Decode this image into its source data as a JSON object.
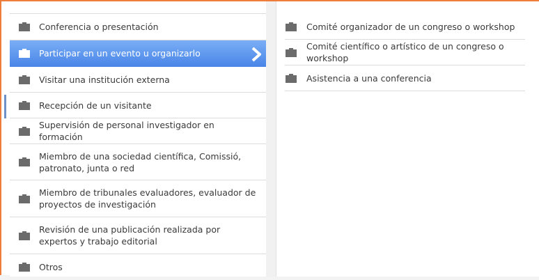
{
  "left_menu": {
    "items": [
      {
        "label": "Conferencia o presentación",
        "icon": "briefcase-icon"
      },
      {
        "label": "Participar en un evento u organizarlo",
        "icon": "briefcase-icon",
        "selected": true
      },
      {
        "label": "Visitar una institución externa",
        "icon": "briefcase-icon"
      },
      {
        "label": "Recepción de un visitante",
        "icon": "briefcase-icon"
      },
      {
        "label": "Supervisión de personal investigador en formación",
        "icon": "briefcase-icon"
      },
      {
        "label": "Miembro de una sociedad científica, Comissió, patronato, junta o red",
        "icon": "briefcase-icon"
      },
      {
        "label": "Miembro de tribunales evaluadores, evaluador de proyectos de investigación",
        "icon": "briefcase-icon"
      },
      {
        "label": "Revisión de una publicación realizada por expertos y trabajo editorial",
        "icon": "briefcase-icon"
      },
      {
        "label": "Otros",
        "icon": "briefcase-icon"
      }
    ]
  },
  "right_menu": {
    "items": [
      {
        "label": "Comité organizador de un congreso o workshop",
        "icon": "briefcase-icon"
      },
      {
        "label": "Comité científico o artístico de un congreso o workshop",
        "icon": "briefcase-icon"
      },
      {
        "label": "Asistencia a una conferencia",
        "icon": "briefcase-icon"
      }
    ]
  },
  "colors": {
    "accent_border": "#ee7c3b",
    "selected_bg": "#4a86e8",
    "icon_gray": "#6b6b6b"
  }
}
